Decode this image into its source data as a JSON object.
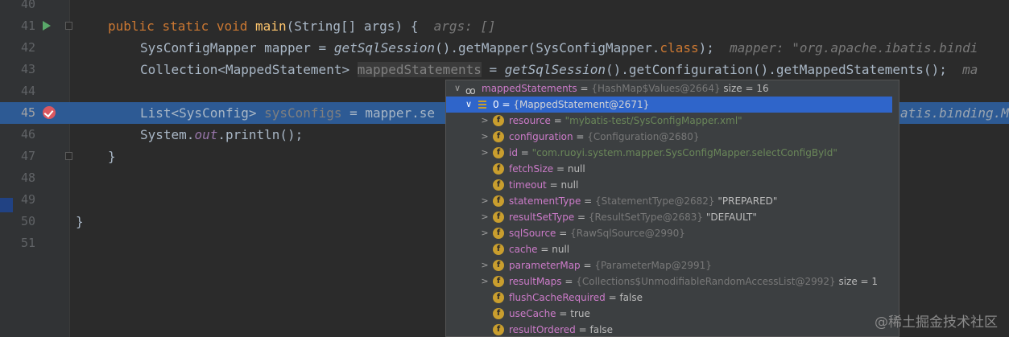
{
  "editor": {
    "lines": [
      {
        "num": "40"
      },
      {
        "num": "41",
        "public": "public",
        "static": "static",
        "void": "void",
        "method": "main",
        "params": "(String[] args) {",
        "hint": "args: []"
      },
      {
        "num": "42",
        "type": "SysConfigMapper mapper = ",
        "call1": "getSqlSession",
        "rest1": "().getMapper(SysConfigMapper.",
        "class_kw": "class",
        "rest2": ");",
        "hint": "mapper: \"org.apache.ibatis.bindi"
      },
      {
        "num": "43",
        "type": "Collection<MappedStatement> ",
        "var": "mappedStatements",
        "eq": " = ",
        "call1": "getSqlSession",
        "rest1": "().getConfiguration().getMappedStatements();",
        "hint": "ma"
      },
      {
        "num": "44"
      },
      {
        "num": "45",
        "type": "List<SysConfig> ",
        "var": "sysConfigs",
        "rest1": " = mapper.se",
        "tail": "atis.binding.M"
      },
      {
        "num": "46",
        "start": "System.",
        "out": "out",
        "rest1": ".println();"
      },
      {
        "num": "47",
        "brace": "}"
      },
      {
        "num": "48"
      },
      {
        "num": "49"
      },
      {
        "num": "50",
        "brace": "}"
      },
      {
        "num": "51"
      }
    ]
  },
  "debug_popup": {
    "rows": [
      {
        "indent": 0,
        "arrow": "∨",
        "icon": "watch-icon",
        "name": "mappedStatements",
        "eq": " = ",
        "type": "{HashMap$Values@2664}",
        "extra": "  size = 16"
      },
      {
        "indent": 1,
        "arrow": "∨",
        "icon": "list-icon",
        "name": "0",
        "eq": " = ",
        "type": "{MappedStatement@2671}",
        "extra": "",
        "selected": true
      },
      {
        "indent": 2,
        "arrow": ">",
        "icon": "f",
        "name": "resource",
        "eq": " = ",
        "str": "\"mybatis-test/SysConfigMapper.xml\""
      },
      {
        "indent": 2,
        "arrow": ">",
        "icon": "f",
        "name": "configuration",
        "eq": " = ",
        "type": "{Configuration@2680}"
      },
      {
        "indent": 2,
        "arrow": ">",
        "icon": "f",
        "name": "id",
        "eq": " = ",
        "str": "\"com.ruoyi.system.mapper.SysConfigMapper.selectConfigById\""
      },
      {
        "indent": 2,
        "arrow": "",
        "icon": "f",
        "name": "fetchSize",
        "eq": " = ",
        "plain": "null"
      },
      {
        "indent": 2,
        "arrow": "",
        "icon": "f",
        "name": "timeout",
        "eq": " = ",
        "plain": "null"
      },
      {
        "indent": 2,
        "arrow": ">",
        "icon": "f",
        "name": "statementType",
        "eq": " = ",
        "type": "{StatementType@2682}",
        "plain": " \"PREPARED\""
      },
      {
        "indent": 2,
        "arrow": ">",
        "icon": "f",
        "name": "resultSetType",
        "eq": " = ",
        "type": "{ResultSetType@2683}",
        "plain": " \"DEFAULT\""
      },
      {
        "indent": 2,
        "arrow": ">",
        "icon": "f",
        "name": "sqlSource",
        "eq": " = ",
        "type": "{RawSqlSource@2990}"
      },
      {
        "indent": 2,
        "arrow": "",
        "icon": "f",
        "name": "cache",
        "eq": " = ",
        "plain": "null"
      },
      {
        "indent": 2,
        "arrow": ">",
        "icon": "f",
        "name": "parameterMap",
        "eq": " = ",
        "type": "{ParameterMap@2991}"
      },
      {
        "indent": 2,
        "arrow": ">",
        "icon": "f",
        "name": "resultMaps",
        "eq": " = ",
        "type": "{Collections$UnmodifiableRandomAccessList@2992}",
        "plain": "  size = 1"
      },
      {
        "indent": 2,
        "arrow": "",
        "icon": "f",
        "name": "flushCacheRequired",
        "eq": " = ",
        "plain": "false"
      },
      {
        "indent": 2,
        "arrow": "",
        "icon": "f",
        "name": "useCache",
        "eq": " = ",
        "plain": "true"
      },
      {
        "indent": 2,
        "arrow": "",
        "icon": "f",
        "name": "resultOrdered",
        "eq": " = ",
        "plain": "false"
      }
    ]
  },
  "watermark": "@稀土掘金技术社区"
}
